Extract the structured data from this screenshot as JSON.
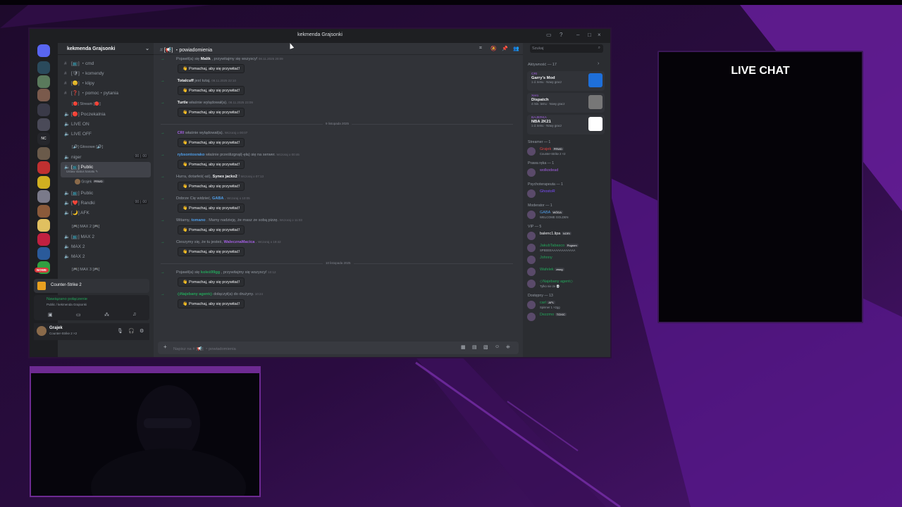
{
  "colors": {
    "accent": "#5865f2",
    "online": "#23a55a",
    "bg_purple": "#6a1fa0"
  },
  "window": {
    "title": "kekmenda Grajsonki"
  },
  "guild": {
    "name": "kekmenda Grajsonki"
  },
  "channels": [
    {
      "label": "[📺] ・cmd",
      "hash": "#"
    },
    {
      "label": "[🛡] ・komendy",
      "hash": "#"
    },
    {
      "label": "[😊] ・klipy",
      "hash": "#"
    },
    {
      "label": "[❓] ・pomoc・pytania",
      "hash": "#"
    }
  ],
  "stream_category": "[🔴] Stream [🔴]",
  "stream_channels": [
    "[🔴] Poczekalnia",
    "LIVE ON",
    "LIVE OFF"
  ],
  "voice_category": "[🔊] Głosowe [🔊]",
  "voice_channels": [
    {
      "label": "niger",
      "stat": "00 ∣ 00"
    },
    {
      "label": "[📺] Public",
      "sub": "Ustaw status kanału ✎",
      "user": "Grajek",
      "user_badge": "PRWD"
    },
    {
      "label": "[📺] Public",
      "stat": ""
    },
    {
      "label": "[❤️] Randki",
      "stat": "00 ∣ 00"
    },
    {
      "label": "[🌙] AFK",
      "stat": ""
    }
  ],
  "max_category": "[🎮] MAX 2 [🎮]",
  "max_channels": [
    "[📺] MAX 2",
    "MAX 2",
    "MAX 2"
  ],
  "max3_category": "[🎮] MAX 3 [🎮]",
  "new_badge": "NOWE",
  "game_activity": "Counter-Strike 2",
  "connection": {
    "status": "Nawiązano połączenie",
    "location": "Public / kekmenda Grajsonki"
  },
  "user": {
    "name": "Grajek",
    "status": "Counter-Strike 2 ×2"
  },
  "channel_header": "[📢] ・powiadomienia",
  "messages": [
    {
      "pre": "Pojawił(a) się",
      "name": "Malik",
      "post": ", przywitajmy się wszyscy!",
      "ts": "08.11.2025 20:09",
      "btn": "Pomachaj, aby się przywitać!",
      "color": "#f2f3f5"
    },
    {
      "pre": "",
      "name": "Totalcuff",
      "post": "jest tutaj.",
      "ts": "08.11.2025 22:10",
      "btn": "Pomachaj, aby się przywitać!",
      "color": "#f2f3f5"
    },
    {
      "pre": "",
      "name": "Turtle",
      "post": "właśnie wylądował(a).",
      "ts": "08.11.2025 23:09",
      "btn": "Pomachaj, aby się przywitać!",
      "color": "#f2f3f5"
    }
  ],
  "divider1": "9 listopada 2025",
  "messages2": [
    {
      "pre": "",
      "name": "CRI",
      "post": "właśnie wylądował(a).",
      "ts": "Wczoraj o 00:07",
      "btn": "Pomachaj, aby się przywitać!",
      "color": "#a25fe0"
    },
    {
      "pre": "",
      "name": "rybsontosrako",
      "post": "właśnie prześlizgnął(-ęła) się na serwer.",
      "ts": "Wczoraj o 00:46",
      "btn": "Pomachaj, aby się przywitać!",
      "color": "#4f9ee8"
    },
    {
      "pre": "Hurra, dotarłeś(-aś),",
      "name": "Synex jackx2",
      "post": "!",
      "ts": "Wczoraj o 07:13",
      "btn": "Pomachaj, aby się przywitać!",
      "color": "#f2f3f5"
    },
    {
      "pre": "Dobrze Cię widzieć,",
      "name": "GABA",
      "post": ".",
      "ts": "Wczoraj o 10:05",
      "btn": "Pomachaj, aby się przywitać!",
      "color": "#4f9ee8"
    },
    {
      "pre": "Witamy,",
      "name": "tomano",
      "post": ". Mamy nadzieję, że masz ze sobą pizzę.",
      "ts": "Wczoraj o 11:03",
      "btn": "Pomachaj, aby się przywitać!",
      "color": "#4f9ee8"
    },
    {
      "pre": "Cieszymy się, że tu jesteś,",
      "name": "WalecznaMacica",
      "post": ".",
      "ts": "Wczoraj o 19:42",
      "btn": "Pomachaj, aby się przywitać!",
      "color": "#a25fe0"
    }
  ],
  "divider2": "10 listopada 2025",
  "messages3": [
    {
      "pre": "Pojawił(a) się",
      "name": "koleś99gg",
      "post": ", przywitajmy się wszyscy!",
      "ts": "10:12",
      "btn": "Pomachaj, aby się przywitać!",
      "color": "#23a55a"
    },
    {
      "pre": "",
      "name": "◇Najebany agent◇",
      "post": "dołączył(a) do drużyny.",
      "ts": "10:24",
      "btn": "Pomachaj, aby się przywitać!",
      "color": "#23a55a"
    }
  ],
  "composer_placeholder": "Napisz na # [📢] ・powiadomienia",
  "search_placeholder": "Szukaj",
  "activity_header": "Aktywność — 17",
  "activities": [
    {
      "user": "CRI",
      "game": "Garry's Mod",
      "meta": "1 d. temu · Nowy gracz",
      "thumb": "#1e6fd9"
    },
    {
      "user": "Xero",
      "game": "Dispatch",
      "meta": "4 min. temu · Nowy gracz",
      "thumb": "#777777"
    },
    {
      "user": "BAJERKA",
      "game": "NBA 2K21",
      "meta": "1 d. temu · Nowy gracz",
      "thumb": "#ffffff"
    }
  ],
  "member_groups": [
    {
      "title": "Streamer — 1",
      "members": [
        {
          "name": "Grajek",
          "badge": "PRWD",
          "sub": "Counter-Strike 2 ×2",
          "color": "#e04040"
        }
      ]
    },
    {
      "title": "Prawa ręka — 1",
      "members": [
        {
          "name": "wolkodead",
          "sub": "",
          "color": "#a25fe0"
        }
      ]
    },
    {
      "title": "Psychoterapeuta — 1",
      "members": [
        {
          "name": "GhostoR",
          "sub": "",
          "color": "#7c4dff"
        }
      ]
    },
    {
      "title": "Moderator — 1",
      "members": [
        {
          "name": "GABA",
          "badge": "WÓDA",
          "sub": "WELCOME GOLDEN",
          "color": "#4f9ee8"
        }
      ]
    },
    {
      "title": "VIP — 5",
      "members": [
        {
          "name": "balenc1.lipa",
          "badge": "NORI",
          "sub": "",
          "color": "#f2f3f5"
        },
        {
          "name": "JakubTabasco",
          "badge": "Pogrom",
          "sub": "SPEEEEAAAAAAAAAAAA",
          "color": "#23a55a"
        },
        {
          "name": "Johnny",
          "sub": "",
          "color": "#23a55a"
        },
        {
          "name": "Wafelek",
          "badge": "zwog",
          "sub": "",
          "color": "#23a55a"
        },
        {
          "name": "◇Najebany agent◇",
          "sub": "Tylko nie ze 💀",
          "color": "#23a55a"
        }
      ]
    },
    {
      "title": "Dostępny — 13",
      "members": [
        {
          "name": "carl",
          "badge": "APL",
          "sub": "Spinner 1 ×2gg",
          "color": "#23a55a"
        },
        {
          "name": "Dezzmo",
          "badge": "TOXIC",
          "sub": "",
          "color": "#23a55a"
        }
      ]
    }
  ],
  "live_chat": "LIVE CHAT"
}
